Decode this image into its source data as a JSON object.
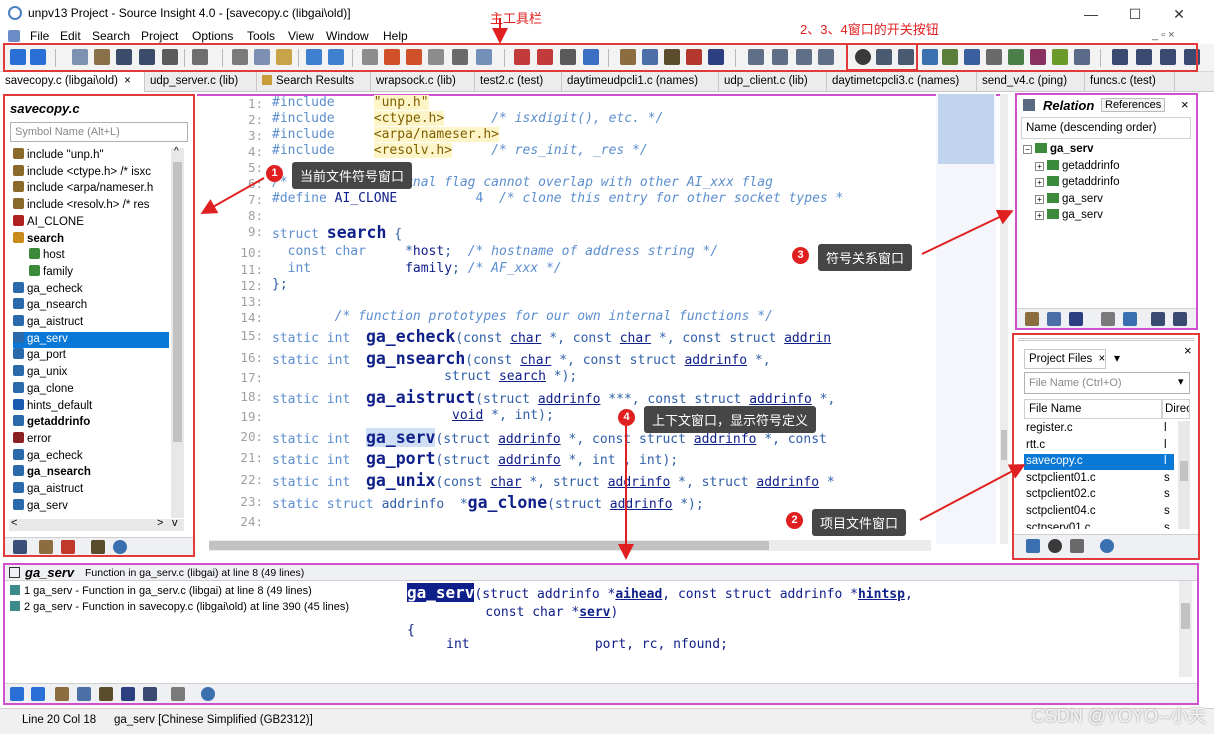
{
  "window": {
    "title": "unpv13 Project - Source Insight 4.0 - [savecopy.c (libgai\\old)]",
    "minimize_glyph": "—",
    "maximize_glyph": "☐",
    "close_glyph": "✕"
  },
  "menu": [
    "File",
    "Edit",
    "Search",
    "Project",
    "Options",
    "Tools",
    "View",
    "Window",
    "Help"
  ],
  "mdi_controls": "_ ▫ ×",
  "tabs": [
    {
      "label": "savecopy.c (libgai\\old)",
      "close": "×"
    },
    {
      "label": "udp_server.c (lib)"
    },
    {
      "label": "Search Results"
    },
    {
      "label": "wrapsock.c (lib)"
    },
    {
      "label": "test2.c (test)"
    },
    {
      "label": "daytimeudpcli1.c (names)"
    },
    {
      "label": "udp_client.c (lib)"
    },
    {
      "label": "daytimetcpcli3.c (names)"
    },
    {
      "label": "send_v4.c (ping)"
    },
    {
      "label": "funcs.c (test)"
    }
  ],
  "symbol_panel": {
    "title": "savecopy.c",
    "search_placeholder": "Symbol Name (Alt+L)",
    "items": [
      {
        "label": "include \"unp.h\"",
        "icon": "include-icon"
      },
      {
        "label": "include <ctype.h> /* isxc",
        "icon": "include-icon"
      },
      {
        "label": "include <arpa/nameser.h",
        "icon": "include-icon"
      },
      {
        "label": "include <resolv.h> /* res",
        "icon": "include-icon"
      },
      {
        "label": "AI_CLONE",
        "icon": "define-icon"
      },
      {
        "label": "search",
        "icon": "struct-icon",
        "bold": true
      },
      {
        "label": "host",
        "icon": "member-icon"
      },
      {
        "label": "family",
        "icon": "member-icon"
      },
      {
        "label": "ga_echeck",
        "icon": "function-icon"
      },
      {
        "label": "ga_nsearch",
        "icon": "function-icon"
      },
      {
        "label": "ga_aistruct",
        "icon": "function-icon"
      },
      {
        "label": "ga_serv",
        "icon": "function-icon",
        "selected": true
      },
      {
        "label": "ga_port",
        "icon": "function-icon"
      },
      {
        "label": "ga_unix",
        "icon": "function-icon"
      },
      {
        "label": "ga_clone",
        "icon": "function-icon"
      },
      {
        "label": "hints_default",
        "icon": "variable-icon"
      },
      {
        "label": "getaddrinfo",
        "icon": "function-icon",
        "bold": true
      },
      {
        "label": "error",
        "icon": "label-icon"
      },
      {
        "label": "ga_echeck",
        "icon": "function-icon"
      },
      {
        "label": "ga_nsearch",
        "icon": "function-icon",
        "bold": true
      },
      {
        "label": "ga_aistruct",
        "icon": "function-icon"
      },
      {
        "label": "ga_serv",
        "icon": "function-icon"
      }
    ],
    "scroll_up": "^",
    "scroll_down": "v",
    "scroll_left": "<",
    "scroll_right": ">"
  },
  "editor": {
    "lines": [
      {
        "n": "1:",
        "parts": [
          [
            "kw",
            "#include"
          ],
          [
            "sp",
            "     "
          ],
          [
            "str",
            "\"unp.h\""
          ]
        ]
      },
      {
        "n": "2:",
        "parts": [
          [
            "kw",
            "#include"
          ],
          [
            "sp",
            "     "
          ],
          [
            "str",
            "<ctype.h>"
          ],
          [
            "sp",
            "      "
          ],
          [
            "cm",
            "/* isxdigit(), etc. */"
          ]
        ]
      },
      {
        "n": "3:",
        "parts": [
          [
            "kw",
            "#include"
          ],
          [
            "sp",
            "     "
          ],
          [
            "str",
            "<arpa/nameser.h>"
          ]
        ]
      },
      {
        "n": "4:",
        "parts": [
          [
            "kw",
            "#include"
          ],
          [
            "sp",
            "     "
          ],
          [
            "str",
            "<resolv.h>"
          ],
          [
            "sp",
            "     "
          ],
          [
            "cm",
            "/* res_init, _res */"
          ]
        ]
      },
      {
        "n": "5:",
        "parts": []
      },
      {
        "n": "6:",
        "parts": [
          [
            "cm",
            "/* following internal flag cannot overlap with other AI_xxx flag"
          ]
        ]
      },
      {
        "n": "7:",
        "parts": [
          [
            "kw",
            "#define"
          ],
          [
            "sp",
            " "
          ],
          [
            "fnsm",
            "AI_CLONE"
          ],
          [
            "sp",
            "          "
          ],
          [
            "num",
            "4"
          ],
          [
            "sp",
            "  "
          ],
          [
            "cm",
            "/* clone this entry for other socket types *"
          ]
        ]
      },
      {
        "n": "8:",
        "parts": []
      },
      {
        "n": "9:",
        "parts": [
          [
            "kw",
            "struct"
          ],
          [
            "sp",
            " "
          ],
          [
            "fn",
            "search"
          ],
          [
            "sp",
            " {"
          ]
        ]
      },
      {
        "n": "10:",
        "parts": [
          [
            "sp",
            "  "
          ],
          [
            "kw",
            "const char"
          ],
          [
            "sp",
            "     *"
          ],
          [
            "id",
            "host"
          ],
          [
            "sp",
            ";  "
          ],
          [
            "cm",
            "/* hostname of address string */"
          ]
        ]
      },
      {
        "n": "11:",
        "parts": [
          [
            "sp",
            "  "
          ],
          [
            "kw",
            "int"
          ],
          [
            "sp",
            "            "
          ],
          [
            "id",
            "family"
          ],
          [
            "sp",
            "; "
          ],
          [
            "cm",
            "/* AF_xxx */"
          ]
        ]
      },
      {
        "n": "12:",
        "parts": [
          [
            "sp",
            "};"
          ]
        ]
      },
      {
        "n": "13:",
        "parts": []
      },
      {
        "n": "14:",
        "parts": [
          [
            "sp",
            "        "
          ],
          [
            "cm",
            "/* function prototypes for our own internal functions */"
          ]
        ]
      },
      {
        "n": "15:",
        "parts": [
          [
            "kw",
            "static int"
          ],
          [
            "sp",
            "  "
          ],
          [
            "fn",
            "ga_echeck"
          ],
          [
            "sp",
            "(const "
          ],
          [
            "ty",
            "char"
          ],
          [
            "sp",
            " *, const "
          ],
          [
            "ty",
            "char"
          ],
          [
            "sp",
            " *, const struct "
          ],
          [
            "ty",
            "addrin"
          ]
        ]
      },
      {
        "n": "16:",
        "parts": [
          [
            "kw",
            "static int"
          ],
          [
            "sp",
            "  "
          ],
          [
            "fn",
            "ga_nsearch"
          ],
          [
            "sp",
            "(const "
          ],
          [
            "ty",
            "char"
          ],
          [
            "sp",
            " *, const struct "
          ],
          [
            "ty",
            "addrinfo"
          ],
          [
            "sp",
            " *,"
          ]
        ]
      },
      {
        "n": "17:",
        "parts": [
          [
            "sp",
            "                      struct "
          ],
          [
            "ty",
            "search"
          ],
          [
            "sp",
            " *);"
          ]
        ]
      },
      {
        "n": "18:",
        "parts": [
          [
            "kw",
            "static int"
          ],
          [
            "sp",
            "  "
          ],
          [
            "fn",
            "ga_aistruct"
          ],
          [
            "sp",
            "(struct "
          ],
          [
            "ty",
            "addrinfo"
          ],
          [
            "sp",
            " ***, const struct "
          ],
          [
            "ty",
            "addrinfo"
          ],
          [
            "sp",
            " *,"
          ]
        ]
      },
      {
        "n": "19:",
        "parts": [
          [
            "sp",
            "                       "
          ],
          [
            "ty",
            "void"
          ],
          [
            "sp",
            " *, int);"
          ]
        ]
      },
      {
        "n": "20:",
        "parts": [
          [
            "kw",
            "static int"
          ],
          [
            "sp",
            "  "
          ],
          [
            "fnhl",
            "ga_serv"
          ],
          [
            "sp",
            "(struct "
          ],
          [
            "ty",
            "addrinfo"
          ],
          [
            "sp",
            " *, const struct "
          ],
          [
            "ty",
            "addrinfo"
          ],
          [
            "sp",
            " *, const"
          ]
        ]
      },
      {
        "n": "21:",
        "parts": [
          [
            "kw",
            "static int"
          ],
          [
            "sp",
            "  "
          ],
          [
            "fn",
            "ga_port"
          ],
          [
            "sp",
            "(struct "
          ],
          [
            "ty",
            "addrinfo"
          ],
          [
            "sp",
            " *, int , int);"
          ]
        ]
      },
      {
        "n": "22:",
        "parts": [
          [
            "kw",
            "static int"
          ],
          [
            "sp",
            "  "
          ],
          [
            "fn",
            "ga_unix"
          ],
          [
            "sp",
            "(const "
          ],
          [
            "ty",
            "char"
          ],
          [
            "sp",
            " *, struct "
          ],
          [
            "ty",
            "addrinfo"
          ],
          [
            "sp",
            " *, struct "
          ],
          [
            "ty",
            "addrinfo"
          ],
          [
            "sp",
            " *"
          ]
        ]
      },
      {
        "n": "23:",
        "parts": [
          [
            "kw",
            "static struct"
          ],
          [
            "sp",
            " addrinfo  *"
          ],
          [
            "fn",
            "ga_clone"
          ],
          [
            "sp",
            "(struct "
          ],
          [
            "ty",
            "addrinfo"
          ],
          [
            "sp",
            " *);"
          ]
        ]
      },
      {
        "n": "24:",
        "parts": []
      }
    ]
  },
  "relation_panel": {
    "title": "Relation",
    "tab2": "References",
    "close": "×",
    "header": "Name (descending order)",
    "tree": [
      {
        "label": "ga_serv",
        "bold": true,
        "indent": 0,
        "expander": "−"
      },
      {
        "label": "getaddrinfo",
        "indent": 1,
        "expander": "+"
      },
      {
        "label": "getaddrinfo",
        "indent": 1,
        "expander": "+"
      },
      {
        "label": "ga_serv",
        "indent": 1,
        "expander": "+"
      },
      {
        "label": "ga_serv",
        "indent": 1,
        "expander": "+"
      }
    ]
  },
  "project_panel": {
    "title": "Project Files",
    "close": "×",
    "dropdown": "▾",
    "search_placeholder": "File Name (Ctrl+O)",
    "col_name": "File Name",
    "col_dir": "Direc",
    "files": [
      {
        "name": "register.c",
        "dir": "l"
      },
      {
        "name": "rtt.c",
        "dir": "l"
      },
      {
        "name": "savecopy.c",
        "dir": "l",
        "selected": true
      },
      {
        "name": "sctpclient01.c",
        "dir": "s"
      },
      {
        "name": "sctpclient02.c",
        "dir": "s"
      },
      {
        "name": "sctpclient04.c",
        "dir": "s"
      },
      {
        "name": "sctpserv01.c",
        "dir": "s"
      }
    ]
  },
  "context_panel": {
    "symbol": "ga_serv",
    "description": "Function in ga_serv.c (libgai) at line 8 (49 lines)",
    "refs": [
      "1 ga_serv - Function in ga_serv.c (libgai) at line 8 (49 lines)",
      "2 ga_serv - Function in savecopy.c (libgai\\old) at line 390 (45 lines)"
    ],
    "code": [
      {
        "parts": [
          [
            "fnhl2",
            "ga_serv"
          ],
          [
            "sp",
            "(struct addrinfo *"
          ],
          [
            "ul",
            "aihead"
          ],
          [
            "sp",
            ", const struct addrinfo *"
          ],
          [
            "ul",
            "hintsp"
          ],
          [
            "sp",
            ","
          ]
        ]
      },
      {
        "parts": [
          [
            "sp",
            "          const char *"
          ],
          [
            "ul",
            "serv"
          ],
          [
            "sp",
            ")"
          ]
        ]
      },
      {
        "parts": [
          [
            "sp",
            "{"
          ]
        ]
      },
      {
        "parts": [
          [
            "sp",
            "     int                port, rc, nfound;"
          ]
        ]
      }
    ]
  },
  "statusbar": {
    "position": "Line 20  Col 18",
    "symbol": "ga_serv [Chinese Simplified (GB2312)]"
  },
  "annotations": {
    "main_toolbar": "主工具栏",
    "toggle_buttons": "2、3、4窗口的开关按钮",
    "callout1": "当前文件符号窗口",
    "callout2": "项目文件窗口",
    "callout3": "符号关系窗口",
    "callout4": "上下文窗口，显示符号定义",
    "n1": "1",
    "n2": "2",
    "n3": "3",
    "n4": "4"
  },
  "watermark": "CSDN @YOYO--小天",
  "colors": {
    "annotation_red": "#e02020",
    "panel_magenta": "#d050d0",
    "selection_blue": "#0a78d7"
  }
}
